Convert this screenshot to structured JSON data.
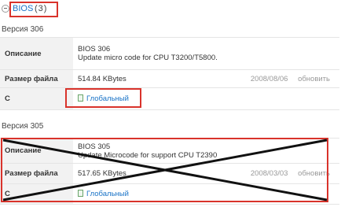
{
  "section": {
    "title": "BIOS",
    "count": "(3)"
  },
  "labels": {
    "description": "Описание",
    "file_size": "Размер файла",
    "c": "С"
  },
  "update_label": "обновить",
  "versions": [
    {
      "title": "Версия 306",
      "desc_line1": "BIOS 306",
      "desc_line2": "Update micro code for CPU T3200/T5800.",
      "size": "514.84 KBytes",
      "date": "2008/08/06",
      "link": "Глобальный"
    },
    {
      "title": "Версия 305",
      "desc_line1": "BIOS 305",
      "desc_line2": "Update Microcode for support CPU T2390",
      "size": "517.65 KBytes",
      "date": "2008/03/03",
      "link": "Глобальный"
    }
  ],
  "colors": {
    "accent": "#1a73c7",
    "highlight": "#d9332b",
    "label_bg": "#f2f2f2"
  },
  "icons": {
    "collapse": "minus-circle-icon",
    "download": "document-icon"
  }
}
